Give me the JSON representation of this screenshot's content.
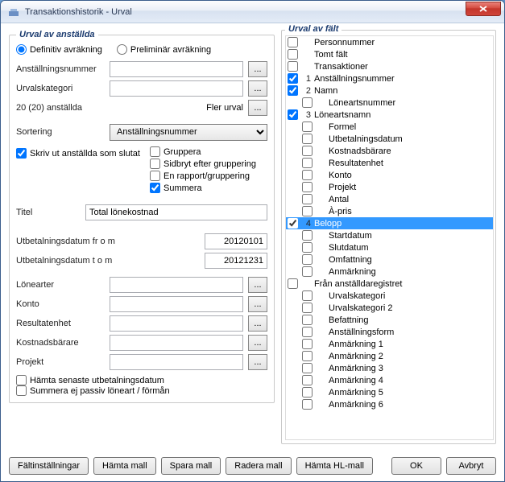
{
  "window": {
    "title": "Transaktionshistorik - Urval"
  },
  "left": {
    "legend": "Urval av anställda",
    "radios": {
      "definitiv": "Definitiv avräkning",
      "preliminar": "Preliminär avräkning"
    },
    "anst_nr_label": "Anställningsnummer",
    "anst_nr_value": "",
    "urvalskat_label": "Urvalskategori",
    "urvalskat_value": "",
    "count_label": "20 (20) anställda",
    "fler_urval_label": "Fler urval",
    "sort_label": "Sortering",
    "sort_value": "Anställningsnummer",
    "skriv_ut_label": "Skriv ut anställda som slutat",
    "grp": {
      "gruppera": "Gruppera",
      "sidbryt": "Sidbryt efter gruppering",
      "enrapport": "En rapport/gruppering",
      "summera": "Summera"
    },
    "titel_label": "Titel",
    "titel_value": "Total lönekostnad",
    "utb_from_label": "Utbetalningsdatum fr o m",
    "utb_from_value": "20120101",
    "utb_tom_label": "Utbetalningsdatum t o m",
    "utb_tom_value": "20121231",
    "lonearter_label": "Lönearter",
    "konto_label": "Konto",
    "resultat_label": "Resultatenhet",
    "kostnad_label": "Kostnadsbärare",
    "projekt_label": "Projekt",
    "lonearter_value": "",
    "konto_value": "",
    "resultat_value": "",
    "kostnad_value": "",
    "projekt_value": "",
    "hamta_senaste": "Hämta senaste utbetalningsdatum",
    "summera_ej": "Summera ej passiv löneart / förmån"
  },
  "right": {
    "legend": "Urval av fält",
    "items": [
      {
        "checked": false,
        "order": "",
        "label": "Personnummer",
        "child": false
      },
      {
        "checked": false,
        "order": "",
        "label": "Tomt fält",
        "child": false
      },
      {
        "checked": false,
        "order": "",
        "label": "Transaktioner",
        "child": false
      },
      {
        "checked": true,
        "order": "1",
        "label": "Anställningsnummer",
        "child": false
      },
      {
        "checked": true,
        "order": "2",
        "label": "Namn",
        "child": false
      },
      {
        "checked": false,
        "order": "",
        "label": "Löneartsnummer",
        "child": true
      },
      {
        "checked": true,
        "order": "3",
        "label": "Löneartsnamn",
        "child": false
      },
      {
        "checked": false,
        "order": "",
        "label": "Formel",
        "child": true
      },
      {
        "checked": false,
        "order": "",
        "label": "Utbetalningsdatum",
        "child": true
      },
      {
        "checked": false,
        "order": "",
        "label": "Kostnadsbärare",
        "child": true
      },
      {
        "checked": false,
        "order": "",
        "label": "Resultatenhet",
        "child": true
      },
      {
        "checked": false,
        "order": "",
        "label": "Konto",
        "child": true
      },
      {
        "checked": false,
        "order": "",
        "label": "Projekt",
        "child": true
      },
      {
        "checked": false,
        "order": "",
        "label": "Antal",
        "child": true
      },
      {
        "checked": false,
        "order": "",
        "label": "À-pris",
        "child": true
      },
      {
        "checked": true,
        "order": "4",
        "label": "Belopp",
        "child": false,
        "selected": true
      },
      {
        "checked": false,
        "order": "",
        "label": "Startdatum",
        "child": true
      },
      {
        "checked": false,
        "order": "",
        "label": "Slutdatum",
        "child": true
      },
      {
        "checked": false,
        "order": "",
        "label": "Omfattning",
        "child": true
      },
      {
        "checked": false,
        "order": "",
        "label": "Anmärkning",
        "child": true
      },
      {
        "checked": false,
        "order": "",
        "label": "Från anställdaregistret",
        "child": false
      },
      {
        "checked": false,
        "order": "",
        "label": "Urvalskategori",
        "child": true
      },
      {
        "checked": false,
        "order": "",
        "label": "Urvalskategori 2",
        "child": true
      },
      {
        "checked": false,
        "order": "",
        "label": "Befattning",
        "child": true
      },
      {
        "checked": false,
        "order": "",
        "label": "Anställningsform",
        "child": true
      },
      {
        "checked": false,
        "order": "",
        "label": "Anmärkning 1",
        "child": true
      },
      {
        "checked": false,
        "order": "",
        "label": "Anmärkning 2",
        "child": true
      },
      {
        "checked": false,
        "order": "",
        "label": "Anmärkning 3",
        "child": true
      },
      {
        "checked": false,
        "order": "",
        "label": "Anmärkning 4",
        "child": true
      },
      {
        "checked": false,
        "order": "",
        "label": "Anmärkning 5",
        "child": true
      },
      {
        "checked": false,
        "order": "",
        "label": "Anmärkning 6",
        "child": true
      }
    ]
  },
  "buttons": {
    "faltinst": "Fältinställningar",
    "hamta_mall": "Hämta mall",
    "spara_mall": "Spara mall",
    "radera_mall": "Radera mall",
    "hamta_hl": "Hämta HL-mall",
    "ok": "OK",
    "avbryt": "Avbryt"
  },
  "ell": "..."
}
